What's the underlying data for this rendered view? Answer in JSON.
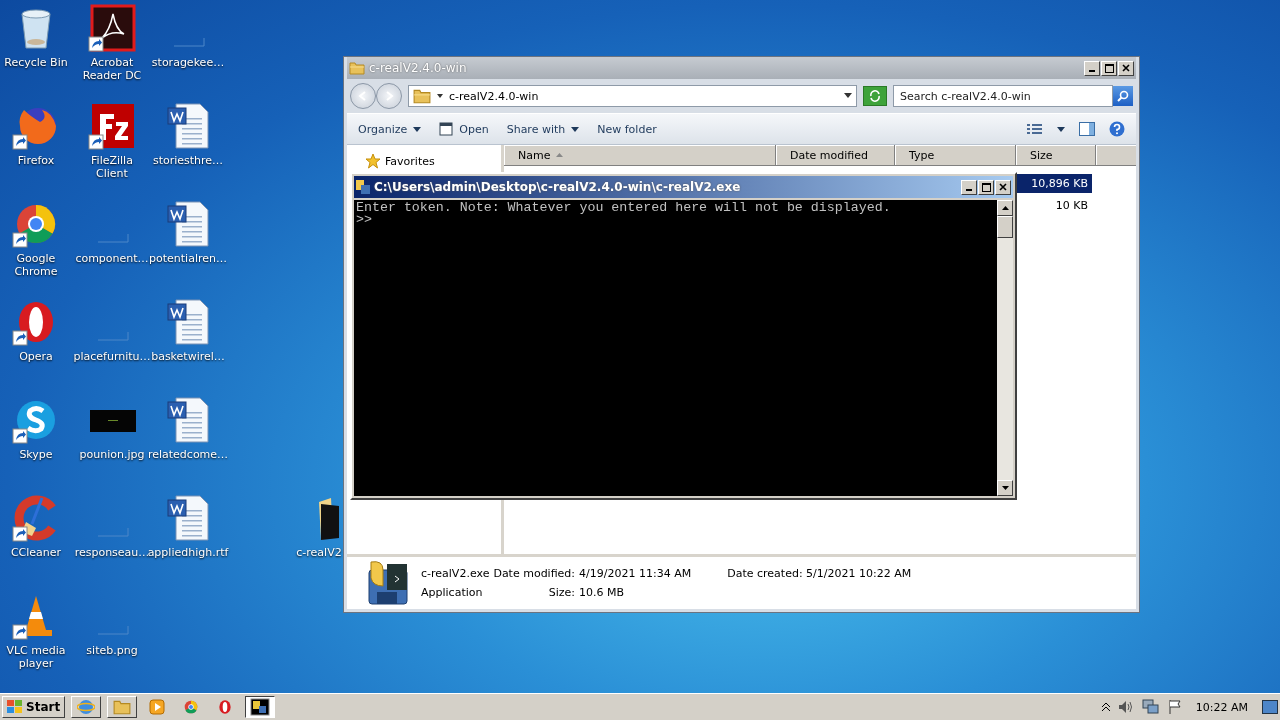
{
  "desktop_icons": [
    {
      "label": "Recycle Bin",
      "kind": "recycle",
      "shortcut": false
    },
    {
      "label": "Firefox",
      "kind": "firefox",
      "shortcut": true
    },
    {
      "label": "Google Chrome",
      "kind": "chrome",
      "shortcut": true
    },
    {
      "label": "Opera",
      "kind": "opera",
      "shortcut": true
    },
    {
      "label": "Skype",
      "kind": "skype",
      "shortcut": true
    },
    {
      "label": "CCleaner",
      "kind": "ccleaner",
      "shortcut": true
    },
    {
      "label": "VLC media player",
      "kind": "vlc",
      "shortcut": true
    },
    {
      "label": "Acrobat Reader DC",
      "kind": "acrobat",
      "shortcut": true
    },
    {
      "label": "FileZilla Client",
      "kind": "filezilla",
      "shortcut": true
    },
    {
      "label": "component…",
      "kind": "blank",
      "shortcut": false
    },
    {
      "label": "placefurnitu…",
      "kind": "blank",
      "shortcut": false
    },
    {
      "label": "pounion.jpg",
      "kind": "image",
      "shortcut": false
    },
    {
      "label": "responseau…",
      "kind": "blank",
      "shortcut": false
    },
    {
      "label": "siteb.png",
      "kind": "blank",
      "shortcut": false
    },
    {
      "label": "storagekee…",
      "kind": "blank",
      "shortcut": false
    },
    {
      "label": "storiesthre…",
      "kind": "word",
      "shortcut": false
    },
    {
      "label": "potentialren…",
      "kind": "word",
      "shortcut": false
    },
    {
      "label": "basketwirel…",
      "kind": "word",
      "shortcut": false
    },
    {
      "label": "relatedcome…",
      "kind": "word",
      "shortcut": false
    },
    {
      "label": "appliedhigh.rtf",
      "kind": "word",
      "shortcut": false
    }
  ],
  "desktop_folder": {
    "label": "c-realV2"
  },
  "explorer": {
    "title": "c-realV2.4.0-win",
    "address": "c-realV2.4.0-win",
    "search": {
      "placeholder": "Search c-realV2.4.0-win"
    },
    "toolbar": [
      {
        "label": "Organize",
        "kind": "menu"
      },
      {
        "label": "Open",
        "kind": "open"
      },
      {
        "label": "Share with",
        "kind": "menu"
      },
      {
        "label": "New folder",
        "kind": "plain"
      }
    ],
    "nav": [
      {
        "label": "Favorites"
      }
    ],
    "columns": [
      "Name",
      "Date modified",
      "Type",
      "Size"
    ],
    "rows": [
      {
        "size": "10,896 KB",
        "selected": true
      },
      {
        "size": "10 KB",
        "selected": false
      }
    ],
    "details": {
      "name": "c-realV2.exe",
      "modified_label": "Date modified:",
      "modified": "4/19/2021 11:34 AM",
      "created_label": "Date created:",
      "created": "5/1/2021 10:22 AM",
      "type": "Application",
      "size_label": "Size:",
      "size": "10.6 MB"
    }
  },
  "console": {
    "title": "C:\\Users\\admin\\Desktop\\c-realV2.4.0-win\\c-realV2.exe",
    "lines": [
      "Enter token. Note: Whatever you entered here will not be displayed.",
      ">>"
    ]
  },
  "taskbar": {
    "start": "Start",
    "items": [
      {
        "kind": "ie",
        "selected": false
      },
      {
        "kind": "explorer",
        "selected": false
      },
      {
        "kind": "media",
        "selected": false
      },
      {
        "kind": "chrome",
        "selected": false
      },
      {
        "kind": "opera",
        "selected": false
      },
      {
        "kind": "console",
        "selected": true
      }
    ],
    "clock": "10:22 AM"
  }
}
